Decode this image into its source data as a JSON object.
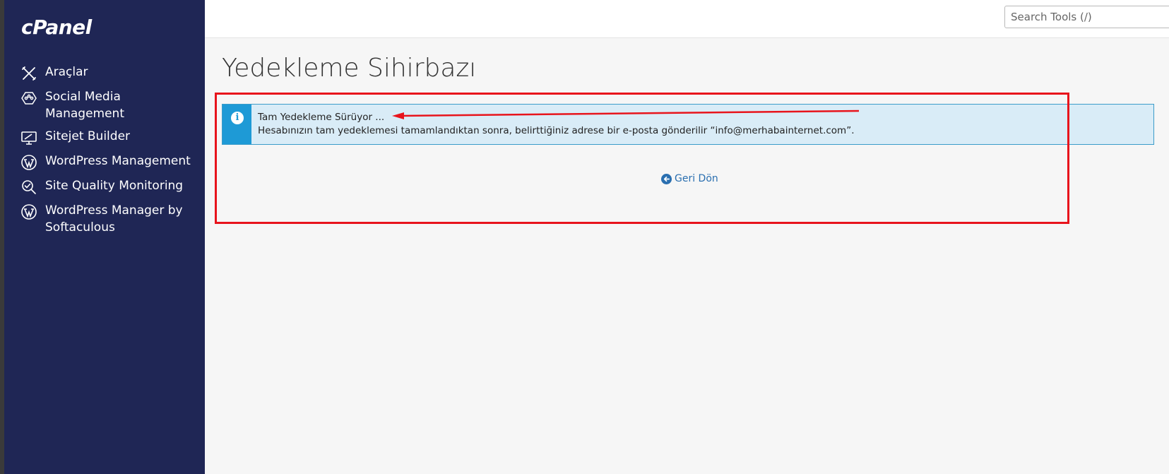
{
  "app": {
    "logo_text": "cPanel"
  },
  "sidebar": {
    "items": [
      {
        "label": "Araçlar",
        "icon": "tools-icon"
      },
      {
        "label": "Social Media Management",
        "icon": "social-media-icon"
      },
      {
        "label": "Sitejet Builder",
        "icon": "sitejet-icon"
      },
      {
        "label": "WordPress Management",
        "icon": "wordpress-icon"
      },
      {
        "label": "Site Quality Monitoring",
        "icon": "site-quality-icon"
      },
      {
        "label": "WordPress Manager by Softaculous",
        "icon": "wordpress-icon"
      }
    ]
  },
  "search": {
    "placeholder": "Search Tools (/)"
  },
  "page": {
    "title": "Yedekleme Sihirbazı"
  },
  "alert": {
    "title": "Tam Yedekleme Sürüyor ...",
    "text": "Hesabınızın tam yedeklemesi tamamlandıktan sonra, belirttiğiniz adrese bir e-posta gönderilir “info@merhabainternet.com”.",
    "icon": "info-icon"
  },
  "back_link": {
    "label": "Geri Dön",
    "icon": "arrow-left-circle-icon"
  },
  "annotation": {
    "color": "#e8141c"
  },
  "colors": {
    "sidebar_bg": "#1f2655",
    "alert_bg": "#d9ecf7",
    "alert_accent": "#1e9ad6",
    "link": "#2a6fb0"
  }
}
